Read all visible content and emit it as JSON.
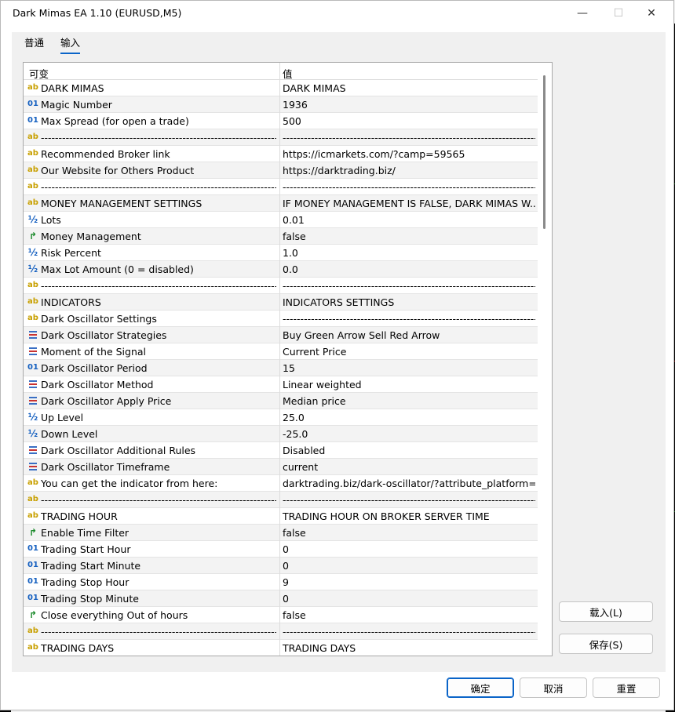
{
  "window": {
    "title": "Dark Mimas EA 1.10 (EURUSD,M5)",
    "min_glyph": "—",
    "max_glyph": "☐",
    "close_glyph": "✕"
  },
  "tabs": [
    {
      "label": "普通"
    },
    {
      "label": "输入"
    }
  ],
  "table": {
    "headers": {
      "variable": "可变",
      "value": "值"
    },
    "rows": [
      {
        "icon": "ab",
        "name": "DARK MIMAS",
        "value": "DARK MIMAS"
      },
      {
        "icon": "01",
        "name": "Magic Number",
        "value": "1936"
      },
      {
        "icon": "01",
        "name": "Max Spread (for open a trade)",
        "value": "500"
      },
      {
        "icon": "ab",
        "name": "----------------------------------------------------------------------------",
        "value": "----------------------------------------------------------------------------"
      },
      {
        "icon": "ab",
        "name": "Recommended Broker link",
        "value": "https://icmarkets.com/?camp=59565"
      },
      {
        "icon": "ab",
        "name": "Our Website for Others Product",
        "value": "https://darktrading.biz/"
      },
      {
        "icon": "ab",
        "name": "----------------------------------------------------------------------------",
        "value": "----------------------------------------------------------------------------"
      },
      {
        "icon": "ab",
        "name": "MONEY MANAGEMENT SETTINGS",
        "value": "IF MONEY MANAGEMENT IS FALSE, DARK MIMAS W..."
      },
      {
        "icon": "½",
        "name": "Lots",
        "value": "0.01"
      },
      {
        "icon": "bool",
        "name": "Money Management",
        "value": "false"
      },
      {
        "icon": "½",
        "name": "Risk Percent",
        "value": "1.0"
      },
      {
        "icon": "½",
        "name": "Max Lot Amount (0 = disabled)",
        "value": "0.0"
      },
      {
        "icon": "ab",
        "name": "----------------------------------------------------------------------------",
        "value": "----------------------------------------------------------------------------"
      },
      {
        "icon": "ab",
        "name": "INDICATORS",
        "value": "INDICATORS SETTINGS"
      },
      {
        "icon": "ab",
        "name": "Dark Oscillator Settings",
        "value": "----------------------------------------------------------------------------"
      },
      {
        "icon": "enum",
        "name": "Dark Oscillator Strategies",
        "value": "Buy Green Arrow Sell Red Arrow"
      },
      {
        "icon": "enum",
        "name": "Moment of the Signal",
        "value": "Current Price"
      },
      {
        "icon": "01",
        "name": "Dark Oscillator Period",
        "value": "15"
      },
      {
        "icon": "enum",
        "name": "Dark Oscillator Method",
        "value": "Linear weighted"
      },
      {
        "icon": "enum",
        "name": "Dark Oscillator Apply Price",
        "value": "Median price"
      },
      {
        "icon": "½",
        "name": "Up Level",
        "value": "25.0"
      },
      {
        "icon": "½",
        "name": "Down Level",
        "value": "-25.0"
      },
      {
        "icon": "enum",
        "name": "Dark Oscillator Additional Rules",
        "value": "Disabled"
      },
      {
        "icon": "enum",
        "name": "Dark Oscillator Timeframe",
        "value": "current"
      },
      {
        "icon": "ab",
        "name": "You can get the indicator from here:",
        "value": "darktrading.biz/dark-oscillator/?attribute_platform=..."
      },
      {
        "icon": "ab",
        "name": "----------------------------------------------------------------------------",
        "value": "----------------------------------------------------------------------------"
      },
      {
        "icon": "ab",
        "name": "TRADING HOUR",
        "value": "TRADING HOUR ON BROKER SERVER TIME"
      },
      {
        "icon": "bool",
        "name": "Enable Time Filter",
        "value": "false"
      },
      {
        "icon": "01",
        "name": "Trading Start Hour",
        "value": "0"
      },
      {
        "icon": "01",
        "name": "Trading Start Minute",
        "value": "0"
      },
      {
        "icon": "01",
        "name": "Trading Stop Hour",
        "value": "9"
      },
      {
        "icon": "01",
        "name": "Trading Stop Minute",
        "value": "0"
      },
      {
        "icon": "bool",
        "name": "Close everything Out of hours",
        "value": "false"
      },
      {
        "icon": "ab",
        "name": "----------------------------------------------------------------------------",
        "value": "----------------------------------------------------------------------------"
      },
      {
        "icon": "ab",
        "name": "TRADING DAYS",
        "value": "TRADING DAYS"
      }
    ]
  },
  "buttons": {
    "load": "载入(L)",
    "save": "保存(S)",
    "ok": "确定",
    "cancel": "取消",
    "reset": "重置"
  }
}
